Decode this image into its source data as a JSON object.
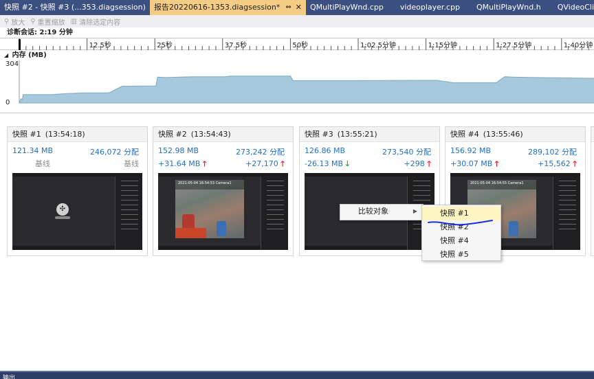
{
  "tabs": [
    {
      "label": "快照 #2 - 快照 #3 (...353.diagsession)",
      "active": false
    },
    {
      "label": "报告20220616-1353.diagsession*",
      "active": true,
      "pin": "⇔",
      "close": "✕"
    },
    {
      "label": "QMultiPlayWnd.cpp",
      "active": false
    },
    {
      "label": "videoplayer.cpp",
      "active": false
    },
    {
      "label": "QMultiPlayWnd.h",
      "active": false
    },
    {
      "label": "QVideoClipCtrl.cpp",
      "active": false
    },
    {
      "label": "Q",
      "active": false
    }
  ],
  "toolbar": {
    "zoom": {
      "label": "放大",
      "icon": "magnifier-icon"
    },
    "reset_zoom": {
      "label": "重置缩放",
      "icon": "magnifier-icon"
    },
    "clear_selection": {
      "label": "清除选定内容",
      "icon": "bar-chart-icon"
    }
  },
  "session": {
    "label": "诊断会话: 2:19 分钟"
  },
  "ruler": {
    "ticks": [
      "12.5秒",
      "25秒",
      "37.5秒",
      "50秒",
      "1:02.5分钟",
      "1:15分钟",
      "1:27.5分钟",
      "1:40分钟"
    ]
  },
  "memory": {
    "title": "内存 (MB)",
    "y_max_label": "304",
    "y_min_label": "0"
  },
  "chart_data": {
    "type": "area",
    "title": "内存 (MB)",
    "xlabel": "",
    "ylabel": "",
    "ylim": [
      0,
      304
    ],
    "x": [
      0.0,
      0.3,
      0.6,
      0.7,
      6.0,
      9.0,
      9.5,
      12.0,
      16.5,
      19.0,
      25.2,
      25.5,
      27.0,
      32.0,
      38.0,
      39.0,
      50.0,
      50.5,
      62.0,
      74.0,
      77.0,
      80.0,
      88.0,
      88.8,
      89.5,
      91.0,
      95.0,
      99.0,
      103.0,
      106.0,
      110.5
    ],
    "series": [
      {
        "values": [
          0,
          30,
          28,
          60,
          60,
          68,
          68,
          72,
          72,
          120,
          122,
          185,
          182,
          188,
          188,
          192,
          192,
          160,
          160,
          162,
          162,
          145,
          145,
          168,
          188,
          185,
          182,
          180,
          178,
          176,
          176
        ]
      }
    ],
    "colors": {
      "fill": "#a7c9dc",
      "stroke": "#7aa9c3"
    },
    "grid": false
  },
  "snapshots": [
    {
      "title": "快照 #1",
      "time": "(13:54:18)",
      "size": "121.34 MB",
      "allocs": "246,072 分配",
      "size_delta": "基线",
      "size_dir": "",
      "allocs_delta": "基线",
      "allocs_dir": "",
      "thumb": "startup"
    },
    {
      "title": "快照 #2",
      "time": "(13:54:43)",
      "size": "152.98 MB",
      "allocs": "273,242 分配",
      "size_delta": "+31.64 MB",
      "size_dir": "up",
      "allocs_delta": "+27,170",
      "allocs_dir": "up",
      "thumb": "video",
      "osd": "2021-05-04 16:54:53   Camera1"
    },
    {
      "title": "快照 #3",
      "time": "(13:55:21)",
      "size": "126.86 MB",
      "allocs": "273,540 分配",
      "size_delta": "-26.13 MB",
      "size_dir": "down",
      "allocs_delta": "+298",
      "allocs_dir": "up",
      "thumb": "blank"
    },
    {
      "title": "快照 #4",
      "time": "(13:55:46)",
      "size": "156.92 MB",
      "allocs": "289,102 分配",
      "size_delta": "+30.07 MB",
      "size_dir": "up",
      "allocs_delta": "+15,562",
      "allocs_dir": "up",
      "thumb": "video",
      "osd": "2021-05-04 16:54:55   Camera1"
    }
  ],
  "context_menu": {
    "compare_label": "比较对象"
  },
  "submenu": {
    "items": [
      "快照 #1",
      "快照 #2",
      "快照 #4",
      "快照 #5"
    ],
    "highlighted": 0
  },
  "status": {
    "text": "输出"
  }
}
